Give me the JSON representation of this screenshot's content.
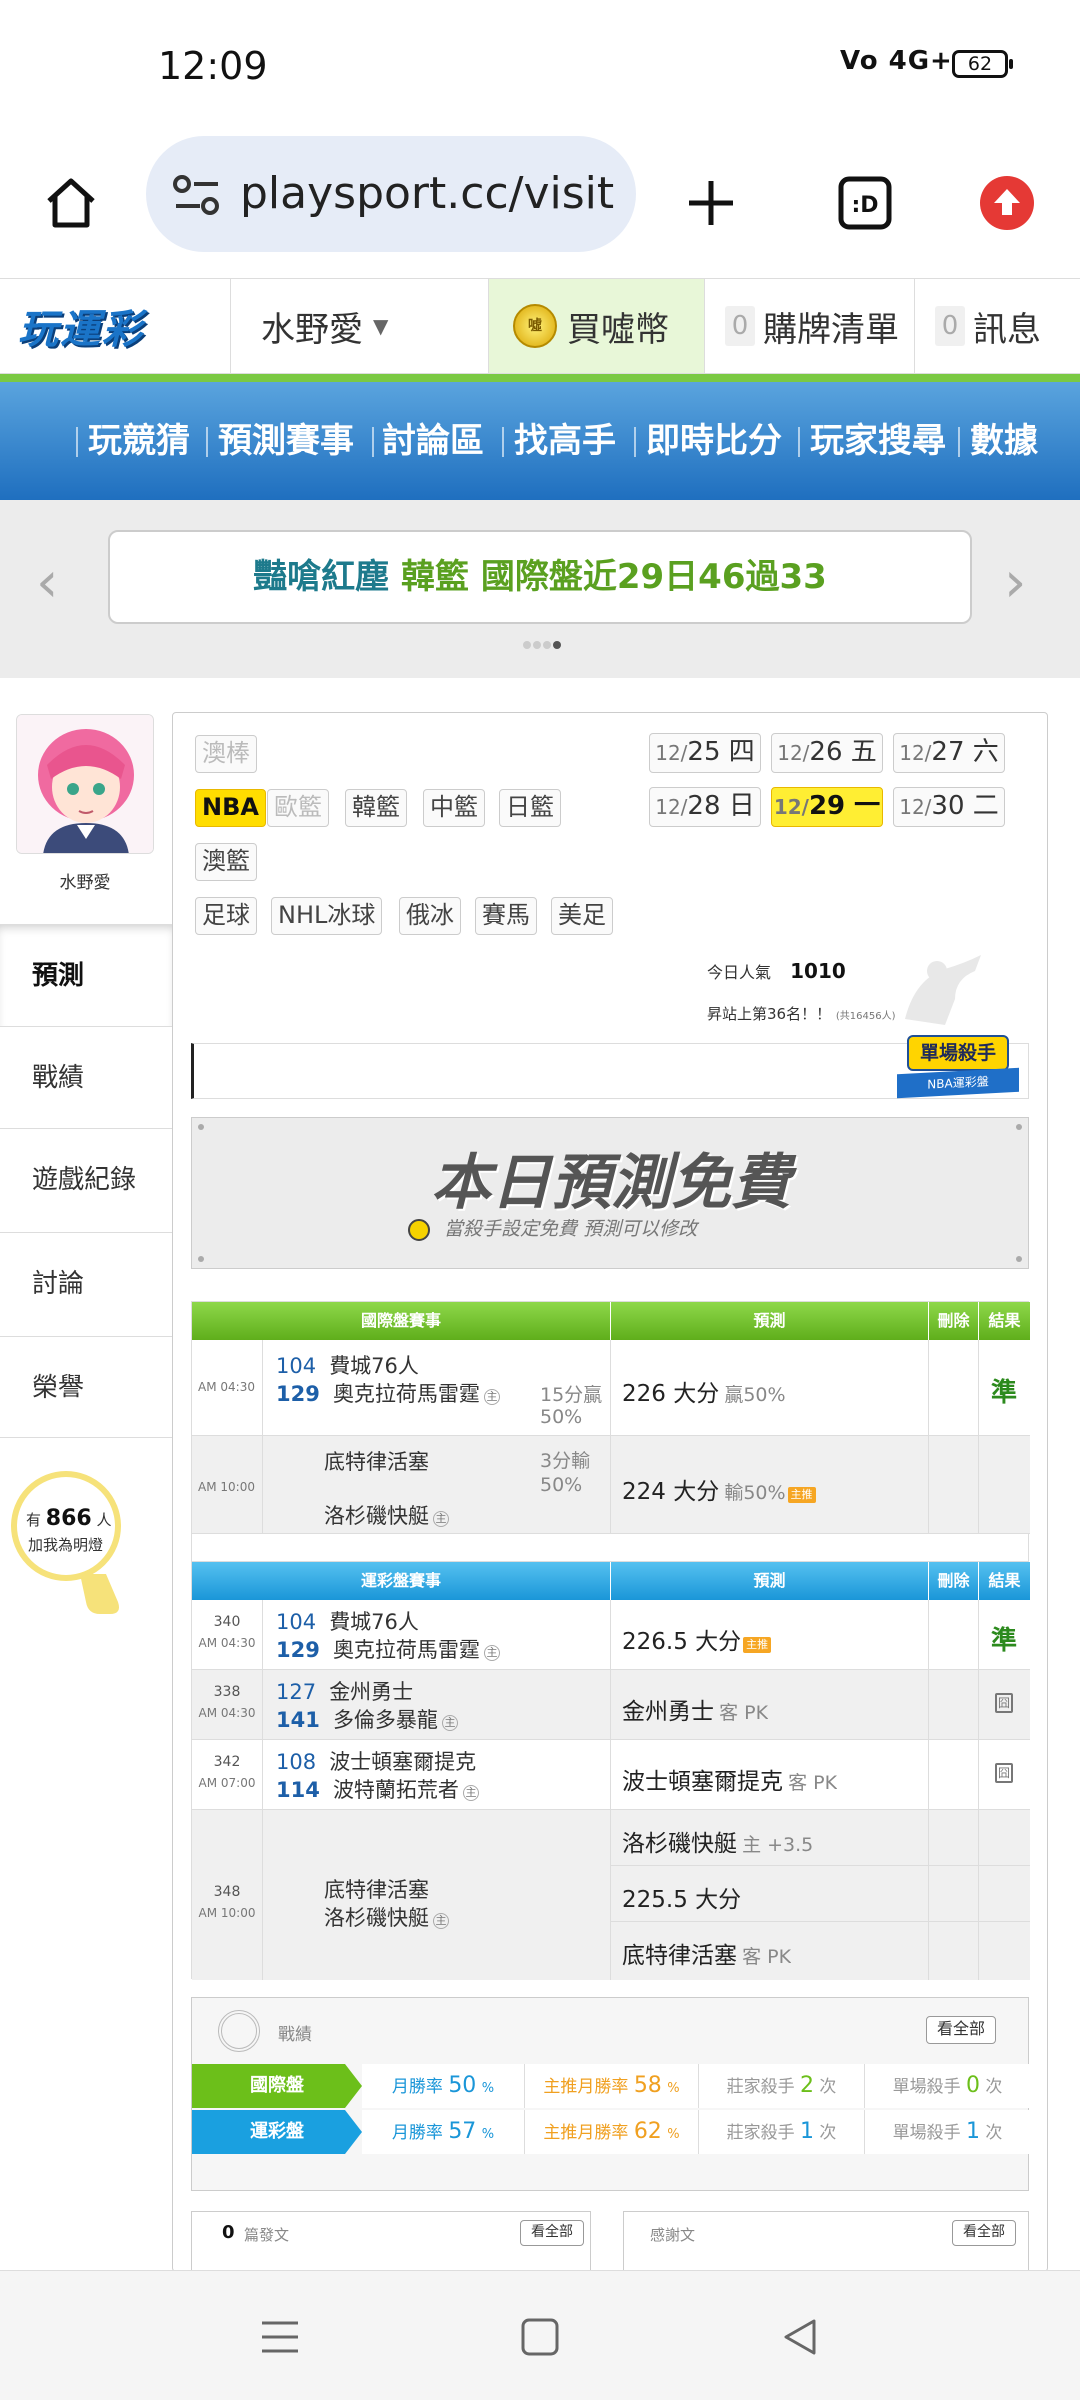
{
  "status_bar": {
    "time": "12:09",
    "signal": "Vo 4G+",
    "battery": "62"
  },
  "browser": {
    "url": "playsport.cc/visit"
  },
  "site_header": {
    "logo": "玩運彩",
    "user": "水野愛",
    "buy": "買噓幣",
    "list_count": "0",
    "list_label": "購牌清單",
    "msg_count": "0",
    "msg_label": "訊息"
  },
  "nav": {
    "items": [
      "玩競猜",
      "預測賽事",
      "討論區",
      "找高手",
      "即時比分",
      "玩家搜尋",
      "數據"
    ]
  },
  "banner": {
    "part1": "豔嗆紅塵",
    "part2": "韓籃",
    "part3": "國際盤近29日46過33"
  },
  "profile": {
    "name": "水野愛",
    "menu": [
      "預測",
      "戰績",
      "遊戲紀錄",
      "討論",
      "榮譽"
    ],
    "fans_prefix": "有",
    "fans_count": "866",
    "fans_unit": "人",
    "fans_label": "加我為明燈"
  },
  "leagues": {
    "row1": [
      "澳棒"
    ],
    "row2": [
      "NBA",
      "歐籃",
      "韓籃",
      "中籃",
      "日籃"
    ],
    "row3": [
      "澳籃"
    ],
    "row4": [
      "足球",
      "NHL冰球",
      "俄冰",
      "賽馬",
      "美足"
    ]
  },
  "dates": [
    {
      "m": "12/",
      "d": "25 四"
    },
    {
      "m": "12/",
      "d": "26 五"
    },
    {
      "m": "12/",
      "d": "27 六"
    },
    {
      "m": "12/",
      "d": "28 日"
    },
    {
      "m": "12/",
      "d": "29 一"
    },
    {
      "m": "12/",
      "d": "30 二"
    }
  ],
  "popularity": {
    "label": "今日人氣",
    "value": "1010",
    "rank": "昇站上第36名！！",
    "rank_note": "(共16456人)"
  },
  "killer_badge": {
    "title": "單場殺手",
    "sub": "NBA運彩盤"
  },
  "free_banner": {
    "title": "本日預測免費",
    "sub": "當殺手設定免費  預測可以修改"
  },
  "intl_table": {
    "headers": [
      "國際盤賽事",
      "預測",
      "刪除",
      "結果"
    ],
    "rows": [
      {
        "time": "AM 04:30",
        "n1": "104",
        "t1": "費城76人",
        "n2": "129",
        "t2": "奧克拉荷馬雷霆",
        "home": "主",
        "line1": "15分贏",
        "line2": "50%",
        "pick": "226 大分",
        "pick_extra": "贏50%",
        "result": "準"
      },
      {
        "time": "AM 10:00",
        "n1": "",
        "t1": "底特律活塞",
        "n2": "",
        "t2": "洛杉磯快艇",
        "home": "主",
        "line1": "3分輸",
        "line2": "50%",
        "pick": "224 大分",
        "pick_extra": "輸50%",
        "tag": "主推",
        "result": ""
      }
    ]
  },
  "lottery_table": {
    "headers": [
      "運彩盤賽事",
      "預測",
      "刪除",
      "結果"
    ],
    "rows": [
      {
        "code": "340",
        "time": "AM 04:30",
        "n1": "104",
        "t1": "費城76人",
        "n2": "129",
        "t2": "奧克拉荷馬雷霆",
        "home": "主",
        "pick": "226.5 大分",
        "tag": "主推",
        "result": "準"
      },
      {
        "code": "338",
        "time": "AM 04:30",
        "n1": "127",
        "t1": "金州勇士",
        "n2": "141",
        "t2": "多倫多暴龍",
        "home": "主",
        "pick": "金州勇士",
        "pick_extra": "客 PK",
        "result": "囧"
      },
      {
        "code": "342",
        "time": "AM 07:00",
        "n1": "108",
        "t1": "波士頓塞爾提克",
        "n2": "114",
        "t2": "波特蘭拓荒者",
        "home": "主",
        "pick": "波士頓塞爾提克",
        "pick_extra": "客 PK",
        "result": "囧"
      }
    ],
    "multi": {
      "code": "348",
      "time": "AM 10:00",
      "t1": "底特律活塞",
      "t2": "洛杉磯快艇",
      "home": "主",
      "picks": [
        {
          "pick": "洛杉磯快艇",
          "extra": "主 +3.5"
        },
        {
          "pick": "225.5 大分",
          "extra": ""
        },
        {
          "pick": "底特律活塞",
          "extra": "客 PK"
        }
      ]
    }
  },
  "stats": {
    "title": "戰績",
    "view_all": "看全部",
    "rows": [
      {
        "label": "國際盤",
        "m1_label": "月勝率",
        "m1": "50",
        "m2_label": "主推月勝率",
        "m2": "58",
        "pct": "%",
        "k1_label": "莊家殺手",
        "k1": "2",
        "k2_label": "單場殺手",
        "k2": "0",
        "unit": "次"
      },
      {
        "label": "運彩盤",
        "m1_label": "月勝率",
        "m1": "57",
        "m2_label": "主推月勝率",
        "m2": "62",
        "pct": "%",
        "k1_label": "莊家殺手",
        "k1": "1",
        "k2_label": "單場殺手",
        "k2": "1",
        "unit": "次"
      }
    ]
  },
  "posts": {
    "count": "0",
    "label": "篇發文",
    "view_all": "看全部",
    "thanks": "感謝文",
    "view_all2": "看全部"
  },
  "colors": {
    "green": "#6cbf1a",
    "blue": "#1aa0e0",
    "accent_yellow": "#ffdd00"
  }
}
